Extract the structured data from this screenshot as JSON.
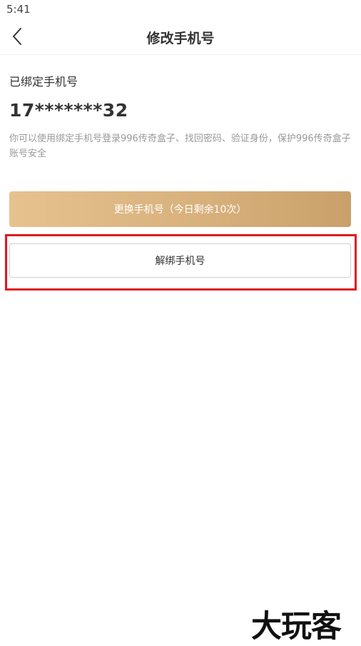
{
  "status_bar": {
    "time": "5:41"
  },
  "nav": {
    "back_icon": "chevron-left-icon",
    "title": "修改手机号"
  },
  "bound": {
    "label": "已绑定手机号",
    "phone": "17*******32",
    "description": "你可以使用绑定手机号登录996传奇盒子、找回密码、验证身份，保护996传奇盒子账号安全"
  },
  "buttons": {
    "change_label": "更换手机号（今日剩余10次）",
    "unbind_label": "解绑手机号"
  },
  "colors": {
    "gold_start": "#e6c28f",
    "gold_end": "#c9a06a",
    "highlight": "#e0191f"
  },
  "watermark": "大玩客"
}
